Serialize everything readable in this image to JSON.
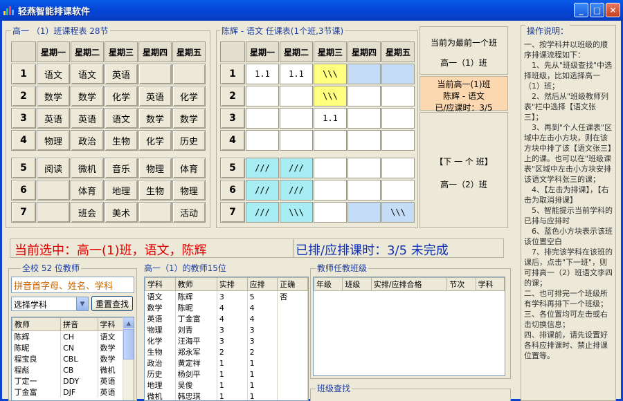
{
  "window": {
    "title": "轻燕智能排课软件",
    "min": "_",
    "max": "□",
    "close": "✕"
  },
  "class_schedule": {
    "title": "高一 （1）班课程表 28节",
    "days": [
      "星期一",
      "星期二",
      "星期三",
      "星期四",
      "星期五"
    ],
    "periods": [
      "1",
      "2",
      "3",
      "4",
      "5",
      "6",
      "7"
    ],
    "cells": [
      [
        "语文",
        "语文",
        "英语",
        "",
        ""
      ],
      [
        "数学",
        "数学",
        "化学",
        "英语",
        "化学"
      ],
      [
        "英语",
        "英语",
        "语文",
        "数学",
        "数学"
      ],
      [
        "物理",
        "政治",
        "生物",
        "化学",
        "历史"
      ],
      [
        "阅读",
        "微机",
        "音乐",
        "物理",
        "体育"
      ],
      [
        "",
        "体育",
        "地理",
        "生物",
        "物理"
      ],
      [
        "",
        "班会",
        "美术",
        "",
        "活动"
      ]
    ]
  },
  "teacher_schedule": {
    "title": "陈辉 - 语文 任课表(1个班,3节课)",
    "days": [
      "星期一",
      "星期二",
      "星期三",
      "星期四",
      "星期五"
    ],
    "periods": [
      "1",
      "2",
      "3",
      "4",
      "5",
      "6",
      "7"
    ],
    "cells": [
      [
        "1.1",
        "1.1",
        "\\\\\\",
        "",
        ""
      ],
      [
        "",
        "",
        "\\\\\\",
        "",
        ""
      ],
      [
        "",
        "",
        "1.1",
        "",
        ""
      ],
      [
        "",
        "",
        "",
        "",
        ""
      ],
      [
        "///",
        "///",
        "",
        "",
        ""
      ],
      [
        "///",
        "///",
        "",
        "",
        ""
      ],
      [
        "///",
        "\\\\\\",
        "",
        "",
        "\\\\\\"
      ]
    ],
    "colors": [
      [
        "white",
        "white",
        "yellow",
        "blue",
        "blue"
      ],
      [
        "white",
        "white",
        "yellow",
        "white",
        "white"
      ],
      [
        "white",
        "white",
        "white",
        "white",
        "white"
      ],
      [
        "white",
        "white",
        "white",
        "white",
        "white"
      ],
      [
        "cyan",
        "cyan",
        "white",
        "white",
        "white"
      ],
      [
        "cyan",
        "cyan",
        "white",
        "white",
        "white"
      ],
      [
        "cyan",
        "cyan",
        "white",
        "blue",
        "blue"
      ]
    ]
  },
  "side": {
    "top_line1": "当前为最前一个班",
    "top_line2": "高一（1）班",
    "mid_line1": "当前高一(1)班",
    "mid_line2": "陈辉 - 语文",
    "mid_line3": "已/应课时：3/5",
    "next_label": "【下 一 个 班】",
    "next_class": "高一（2）班"
  },
  "status": {
    "left": "当前选中：高一(1)班，语文，陈辉",
    "right": "已排/应排课时：3/5 未完成"
  },
  "teachers_all": {
    "title": "全校 52 位教师",
    "search_placeholder": "拼音首字母、姓名、学科",
    "subject_select": "选择学科",
    "reset_button": "重置查找",
    "columns": [
      "教师",
      "拼音",
      "学科"
    ],
    "rows": [
      [
        "陈辉",
        "CH",
        "语文"
      ],
      [
        "陈昵",
        "CN",
        "数学"
      ],
      [
        "程宝良",
        "CBL",
        "数学"
      ],
      [
        "程彪",
        "CB",
        "微机"
      ],
      [
        "丁定一",
        "DDY",
        "英语"
      ],
      [
        "丁金富",
        "DJF",
        "英语"
      ]
    ]
  },
  "class_teachers": {
    "title": "高一（1）的教师15位",
    "columns": [
      "学科",
      "教师",
      "实排",
      "应排",
      "正确"
    ],
    "rows": [
      [
        "语文",
        "陈辉",
        "3",
        "5",
        "否"
      ],
      [
        "数学",
        "陈昵",
        "4",
        "4",
        ""
      ],
      [
        "英语",
        "丁金富",
        "4",
        "4",
        ""
      ],
      [
        "物理",
        "刘青",
        "3",
        "3",
        ""
      ],
      [
        "化学",
        "汪海平",
        "3",
        "3",
        ""
      ],
      [
        "生物",
        "郑永军",
        "2",
        "2",
        ""
      ],
      [
        "政治",
        "黄定祥",
        "1",
        "1",
        ""
      ],
      [
        "历史",
        "杨剑平",
        "1",
        "1",
        ""
      ],
      [
        "地理",
        "吴俊",
        "1",
        "1",
        ""
      ],
      [
        "微机",
        "韩忠琪",
        "1",
        "1",
        ""
      ]
    ]
  },
  "teacher_classes": {
    "title": "教师任教班级",
    "columns": [
      "年级",
      "班级",
      "实排/应排合格",
      "节次",
      "学科"
    ]
  },
  "class_search": {
    "title": "班级查找"
  },
  "help": {
    "title": "操作说明：",
    "text": "一、按学科并以班级的顺序排课流程如下：\n　1、先从\"班级查找\"中选择班级，比如选择高一（1）班；\n　2、然后从\"班级教师列表\"栏中选择【语文张三】；\n　3、再到\"个人任课表\"区域中左击小方块，则在该方块中排了该【语文张三】上的课。也可以在\"班级课表\"区域中左击小方块安排该语文学科张三的课；\n　4、【左击为排课】，【右击为取消排课】\n　5、智能提示当前学科的已排与应排时\n　6、蓝色小方块表示该班该位置空白\n　7、排完该学科在该班的课后，点击\"下一班\"，则可排高一（2）班语文李四的课；\n二、也可排完一个班级所有学科再排下一个班级；\n三、各位置均可左击或右击切换信息；\n四、排课前，请先设置好各科应排课时、禁止排课位置等。"
  }
}
